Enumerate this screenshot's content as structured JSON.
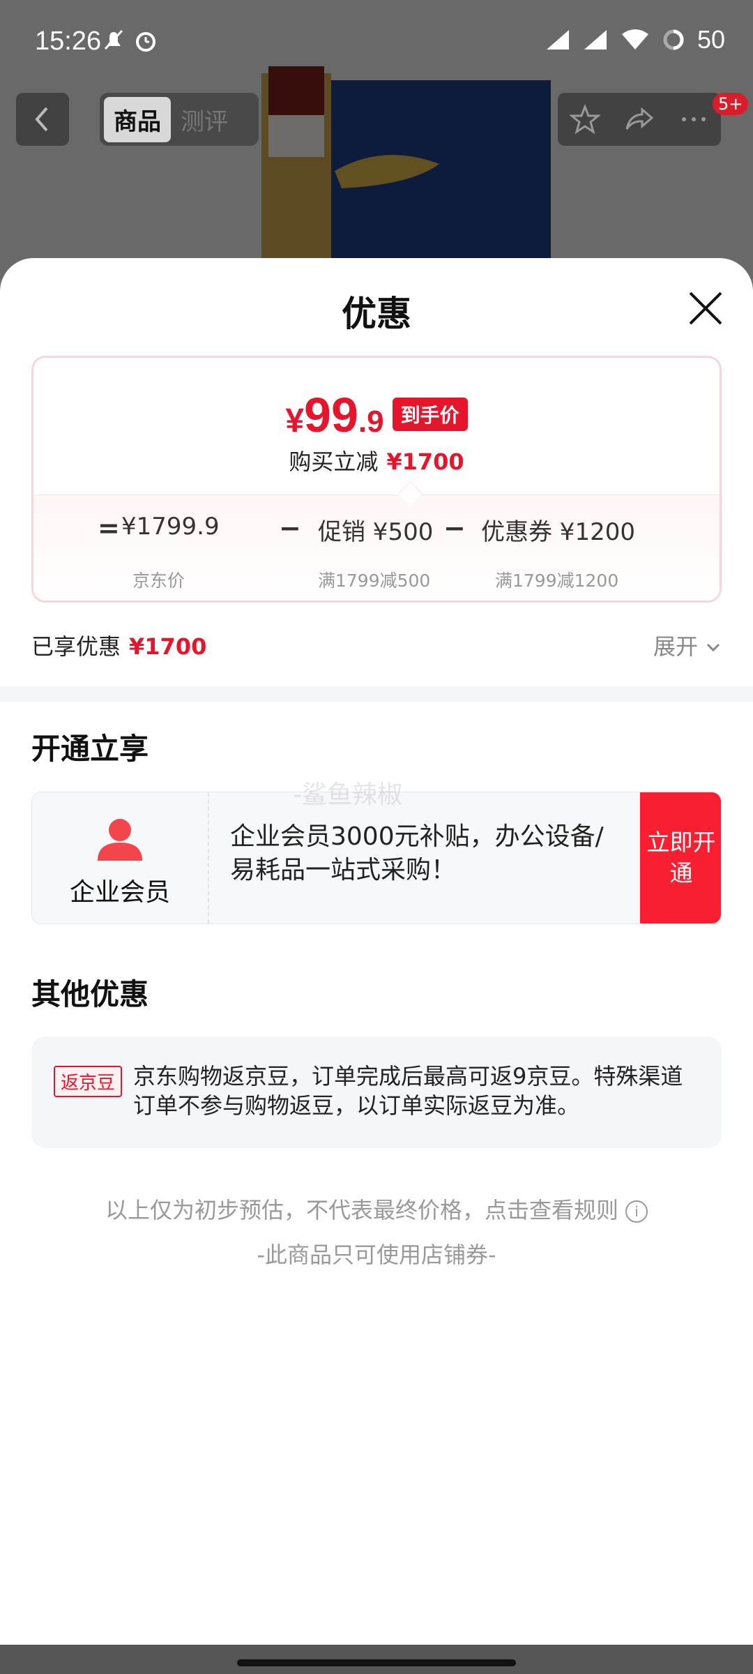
{
  "status_bar": {
    "time": "15:26",
    "battery": "50"
  },
  "top_nav": {
    "tabs": [
      "商品",
      "测评"
    ],
    "badge": "5+"
  },
  "sheet": {
    "title": "优惠",
    "price": {
      "currency": "¥",
      "integer": "99",
      "decimal": ".9",
      "tag": "到手价",
      "reduce_label": "购买立减",
      "reduce_value": "¥1700"
    },
    "formula": {
      "equals": "=",
      "base_price": "¥1799.9",
      "base_label": "京东价",
      "minus": "−",
      "promo": "促销 ¥500",
      "promo_rule": "满1799减500",
      "coupon": "优惠券 ¥1200",
      "coupon_rule": "满1799减1200"
    },
    "enjoyed": {
      "label": "已享优惠",
      "value": "¥1700",
      "expand": "展开"
    },
    "open_section": {
      "title": "开通立享",
      "member_label": "企业会员",
      "description": "企业会员3000元补贴，办公设备/易耗品一站式采购！",
      "button": "立即开通",
      "watermark": "-鲨鱼辣椒"
    },
    "other_section": {
      "title": "其他优惠",
      "tag": "返京豆",
      "text": "京东购物返京豆，订单完成后最高可返9京豆。特殊渠道订单不参与购物返豆，以订单实际返豆为准。"
    },
    "notes": {
      "estimate": "以上仅为初步预估，不代表最终价格，点击查看规则",
      "store_coupon": "-此商品只可使用店铺券-"
    }
  },
  "colors": {
    "accent_red": "#e5152b",
    "button_red": "#fa1e31"
  }
}
